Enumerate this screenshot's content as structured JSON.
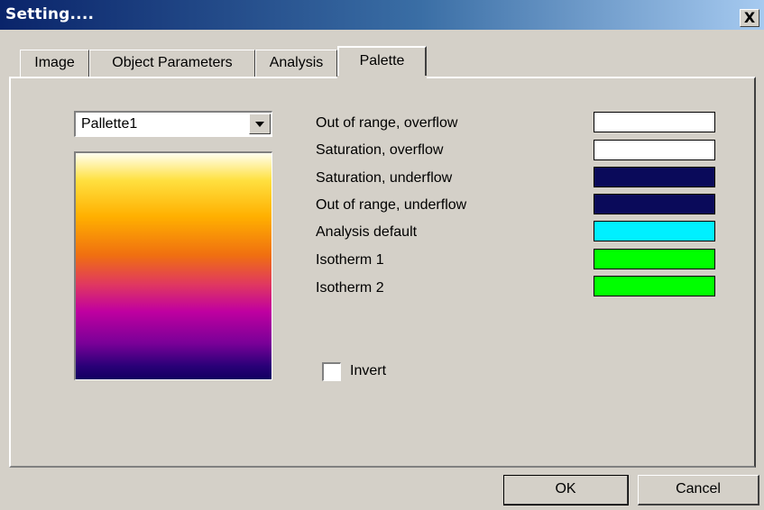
{
  "window": {
    "title": "Setting....",
    "close_label": "X"
  },
  "tabs": [
    {
      "label": "Image",
      "active": false
    },
    {
      "label": "Object Parameters",
      "active": false
    },
    {
      "label": "Analysis",
      "active": false
    },
    {
      "label": "Palette",
      "active": true
    }
  ],
  "palette": {
    "selected": "Pallette1",
    "invert_label": "Invert",
    "invert_checked": false,
    "colors": [
      {
        "label": "Out of range, overflow",
        "color": "#ffffff"
      },
      {
        "label": "Saturation, overflow",
        "color": "#ffffff"
      },
      {
        "label": "Saturation, underflow",
        "color": "#0a0a5a"
      },
      {
        "label": "Out of range, underflow",
        "color": "#0a0a5a"
      },
      {
        "label": "Analysis default",
        "color": "#00f0ff"
      },
      {
        "label": "Isotherm 1",
        "color": "#00ff00"
      },
      {
        "label": "Isotherm 2",
        "color": "#00ff00"
      }
    ]
  },
  "buttons": {
    "ok": "OK",
    "cancel": "Cancel"
  }
}
